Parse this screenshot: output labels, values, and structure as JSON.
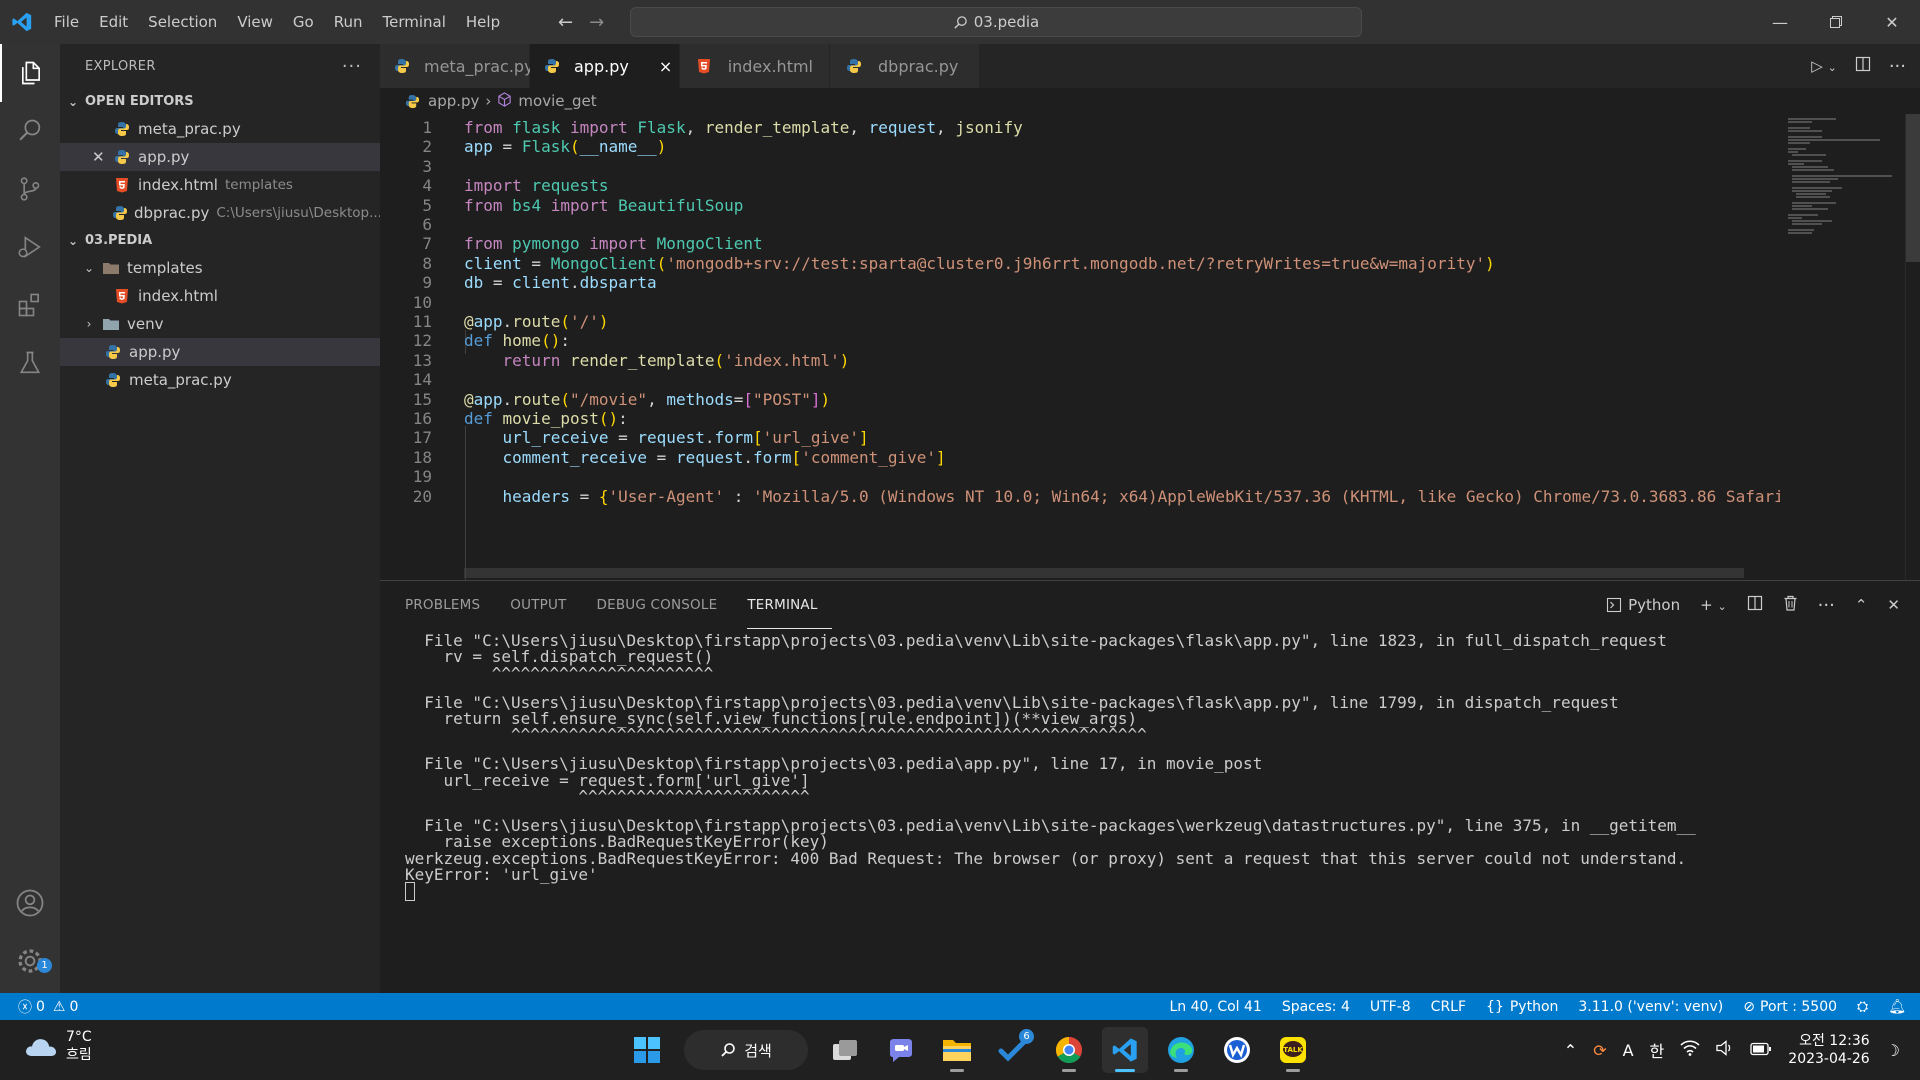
{
  "menu": [
    "File",
    "Edit",
    "Selection",
    "View",
    "Go",
    "Run",
    "Terminal",
    "Help"
  ],
  "command_center": "03.pedia",
  "sidebar": {
    "title": "EXPLORER",
    "open_editors_label": "OPEN EDITORS",
    "open_editors": [
      {
        "name": "meta_prac.py",
        "desc": ""
      },
      {
        "name": "app.py",
        "desc": ""
      },
      {
        "name": "index.html",
        "desc": "templates"
      },
      {
        "name": "dbprac.py",
        "desc": "C:\\Users\\jiusu\\Desktop..."
      }
    ],
    "folder_label": "03.PEDIA",
    "tree": [
      {
        "name": "templates"
      },
      {
        "name": "index.html"
      },
      {
        "name": "venv"
      },
      {
        "name": "app.py"
      },
      {
        "name": "meta_prac.py"
      }
    ]
  },
  "tabs": [
    {
      "label": "meta_prac.py"
    },
    {
      "label": "app.py",
      "close": "×"
    },
    {
      "label": "index.html"
    },
    {
      "label": "dbprac.py"
    }
  ],
  "breadcrumb": {
    "file": "app.py",
    "sep": "›",
    "symbol": "movie_get"
  },
  "editor": {
    "lines": [
      {
        "n": "1",
        "t": [
          [
            "kw",
            "from "
          ],
          [
            "cls",
            "flask "
          ],
          [
            "kw",
            "import "
          ],
          [
            "cls",
            "Flask"
          ],
          [
            "plain",
            ", "
          ],
          [
            "fn",
            "render_template"
          ],
          [
            "plain",
            ", "
          ],
          [
            "var",
            "request"
          ],
          [
            "plain",
            ", "
          ],
          [
            "fn",
            "jsonify"
          ]
        ]
      },
      {
        "n": "2",
        "t": [
          [
            "var",
            "app"
          ],
          [
            "plain",
            " = "
          ],
          [
            "cls",
            "Flask"
          ],
          [
            "br1",
            "("
          ],
          [
            "var",
            "__name__"
          ],
          [
            "br1",
            ")"
          ]
        ]
      },
      {
        "n": "3",
        "t": []
      },
      {
        "n": "4",
        "t": [
          [
            "kw",
            "import "
          ],
          [
            "cls",
            "requests"
          ]
        ]
      },
      {
        "n": "5",
        "t": [
          [
            "kw",
            "from "
          ],
          [
            "cls",
            "bs4 "
          ],
          [
            "kw",
            "import "
          ],
          [
            "cls",
            "BeautifulSoup"
          ]
        ]
      },
      {
        "n": "6",
        "t": []
      },
      {
        "n": "7",
        "t": [
          [
            "kw",
            "from "
          ],
          [
            "cls",
            "pymongo "
          ],
          [
            "kw",
            "import "
          ],
          [
            "cls",
            "MongoClient"
          ]
        ]
      },
      {
        "n": "8",
        "t": [
          [
            "var",
            "client"
          ],
          [
            "plain",
            " = "
          ],
          [
            "cls",
            "MongoClient"
          ],
          [
            "br1",
            "("
          ],
          [
            "str",
            "'mongodb+srv://test:sparta@cluster0.j9h6rrt.mongodb.net/?retryWrites=true&w=majority'"
          ],
          [
            "br1",
            ")"
          ]
        ]
      },
      {
        "n": "9",
        "t": [
          [
            "var",
            "db"
          ],
          [
            "plain",
            " = "
          ],
          [
            "var",
            "client"
          ],
          [
            "plain",
            "."
          ],
          [
            "var",
            "dbsparta"
          ]
        ]
      },
      {
        "n": "10",
        "t": []
      },
      {
        "n": "11",
        "t": [
          [
            "dec",
            "@"
          ],
          [
            "var",
            "app"
          ],
          [
            "plain",
            "."
          ],
          [
            "fn",
            "route"
          ],
          [
            "br1",
            "("
          ],
          [
            "str",
            "'/'"
          ],
          [
            "br1",
            ")"
          ]
        ]
      },
      {
        "n": "12",
        "t": [
          [
            "kw2",
            "def "
          ],
          [
            "fn",
            "home"
          ],
          [
            "br1",
            "()"
          ],
          [
            "plain",
            ":"
          ]
        ]
      },
      {
        "n": "13",
        "t": [
          [
            "plain",
            "    "
          ],
          [
            "kw",
            "return "
          ],
          [
            "fn",
            "render_template"
          ],
          [
            "br1",
            "("
          ],
          [
            "str",
            "'index.html'"
          ],
          [
            "br1",
            ")"
          ]
        ]
      },
      {
        "n": "14",
        "t": []
      },
      {
        "n": "15",
        "t": [
          [
            "dec",
            "@"
          ],
          [
            "var",
            "app"
          ],
          [
            "plain",
            "."
          ],
          [
            "fn",
            "route"
          ],
          [
            "br1",
            "("
          ],
          [
            "str",
            "\"/movie\""
          ],
          [
            "plain",
            ", "
          ],
          [
            "var",
            "methods"
          ],
          [
            "plain",
            "="
          ],
          [
            "br2",
            "["
          ],
          [
            "str",
            "\"POST\""
          ],
          [
            "br2",
            "]"
          ],
          [
            "br1",
            ")"
          ]
        ]
      },
      {
        "n": "16",
        "t": [
          [
            "kw2",
            "def "
          ],
          [
            "fn",
            "movie_post"
          ],
          [
            "br1",
            "()"
          ],
          [
            "plain",
            ":"
          ]
        ]
      },
      {
        "n": "17",
        "t": [
          [
            "plain",
            "    "
          ],
          [
            "var",
            "url_receive"
          ],
          [
            "plain",
            " = "
          ],
          [
            "var",
            "request"
          ],
          [
            "plain",
            "."
          ],
          [
            "var",
            "form"
          ],
          [
            "br1",
            "["
          ],
          [
            "str",
            "'url_give'"
          ],
          [
            "br1",
            "]"
          ]
        ]
      },
      {
        "n": "18",
        "t": [
          [
            "plain",
            "    "
          ],
          [
            "var",
            "comment_receive"
          ],
          [
            "plain",
            " = "
          ],
          [
            "var",
            "request"
          ],
          [
            "plain",
            "."
          ],
          [
            "var",
            "form"
          ],
          [
            "br1",
            "["
          ],
          [
            "str",
            "'comment_give'"
          ],
          [
            "br1",
            "]"
          ]
        ]
      },
      {
        "n": "19",
        "t": []
      },
      {
        "n": "20",
        "t": [
          [
            "plain",
            "    "
          ],
          [
            "var",
            "headers"
          ],
          [
            "plain",
            " = "
          ],
          [
            "br1",
            "{"
          ],
          [
            "str",
            "'User-Agent'"
          ],
          [
            "plain",
            " : "
          ],
          [
            "str",
            "'Mozilla/5.0 (Windows NT 10.0; Win64; x64)AppleWebKit/537.36 (KHTML, like Gecko) Chrome/73.0.3683.86 Safari"
          ]
        ]
      }
    ]
  },
  "panel": {
    "tabs": [
      "PROBLEMS",
      "OUTPUT",
      "DEBUG CONSOLE",
      "TERMINAL"
    ],
    "shell": "Python",
    "terminal_lines": [
      "  File \"C:\\Users\\jiusu\\Desktop\\firstapp\\projects\\03.pedia\\venv\\Lib\\site-packages\\flask\\app.py\", line 1823, in full_dispatch_request",
      "    rv = self.dispatch_request()",
      "         ^^^^^^^^^^^^^^^^^^^^^^^",
      "  File \"C:\\Users\\jiusu\\Desktop\\firstapp\\projects\\03.pedia\\venv\\Lib\\site-packages\\flask\\app.py\", line 1799, in dispatch_request",
      "    return self.ensure_sync(self.view_functions[rule.endpoint])(**view_args)",
      "           ^^^^^^^^^^^^^^^^^^^^^^^^^^^^^^^^^^^^^^^^^^^^^^^^^^^^^^^^^^^^^^^^^^",
      "  File \"C:\\Users\\jiusu\\Desktop\\firstapp\\projects\\03.pedia\\app.py\", line 17, in movie_post",
      "    url_receive = request.form['url_give']",
      "                  ^^^^^^^^^^^^^^^^^^^^^^^^",
      "  File \"C:\\Users\\jiusu\\Desktop\\firstapp\\projects\\03.pedia\\venv\\Lib\\site-packages\\werkzeug\\datastructures.py\", line 375, in __getitem__",
      "    raise exceptions.BadRequestKeyError(key)",
      "werkzeug.exceptions.BadRequestKeyError: 400 Bad Request: The browser (or proxy) sent a request that this server could not understand.",
      "KeyError: 'url_give'"
    ]
  },
  "status": {
    "errors": "0",
    "warnings": "0",
    "position": "Ln 40, Col 41",
    "spaces": "Spaces: 4",
    "encoding": "UTF-8",
    "eol": "CRLF",
    "language": "Python",
    "interpreter": "3.11.0 ('venv': venv)",
    "port": "Port : 5500"
  },
  "activity": {
    "settings_badge": "1"
  },
  "taskbar": {
    "temp": "7°C",
    "weather": "흐림",
    "search": "검색",
    "todo_badge": "6",
    "ime_a": "A",
    "ime_han": "한",
    "time": "오전 12:36",
    "date": "2023-04-26"
  },
  "colors": {
    "accent": "#007acc",
    "python_blue": "#3572A5",
    "python_yellow": "#f7c948",
    "html_orange": "#e44d26"
  }
}
